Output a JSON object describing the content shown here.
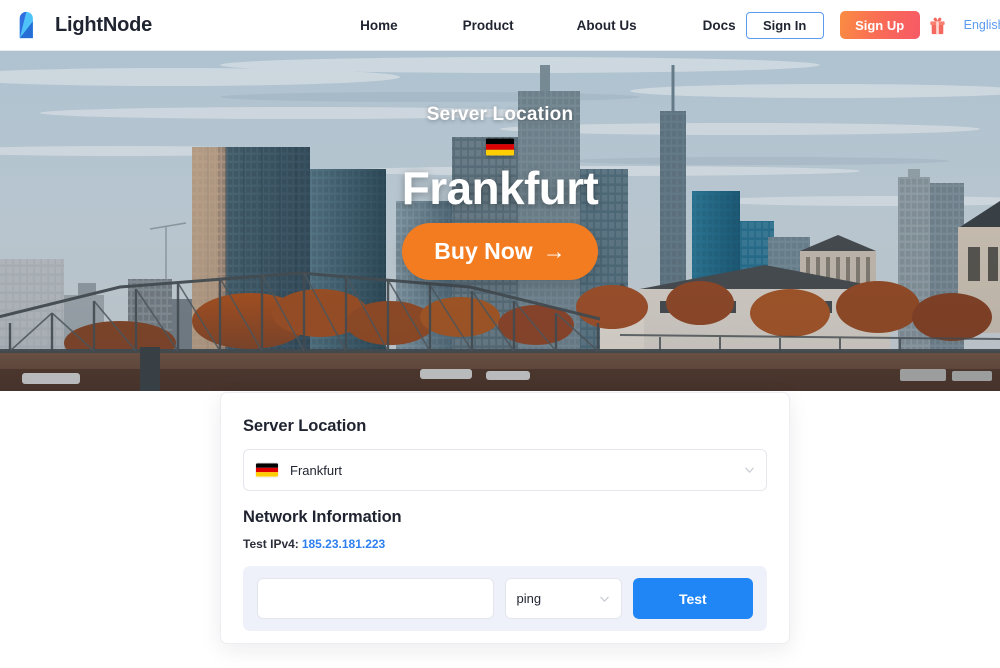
{
  "header": {
    "brand_name": "LightNode",
    "logo_icon": "lightnode-logo-icon",
    "nav": [
      {
        "label": "Home"
      },
      {
        "label": "Product"
      },
      {
        "label": "About Us"
      },
      {
        "label": "Docs"
      }
    ],
    "sign_in_label": "Sign In",
    "sign_up_label": "Sign Up",
    "gift_icon": "gift-icon",
    "language_label": "English",
    "colors": {
      "signin_border": "#5b9bf0",
      "signup_gradient_from": "#fa8c42",
      "signup_gradient_to": "#f75a66",
      "language_link": "#5b9bf0"
    }
  },
  "hero": {
    "label": "Server Location",
    "flag_icon": "flag-germany-icon",
    "city": "Frankfurt",
    "cta_label": "Buy Now",
    "cta_arrow": "→",
    "cta_color": "#f47c20",
    "background_alt": "Frankfurt skyline with Eiserner Steg bridge at dusk"
  },
  "card": {
    "server_location_title": "Server Location",
    "location_select": {
      "flag_icon": "flag-germany-icon",
      "value": "Frankfurt",
      "chevron_icon": "chevron-down-icon"
    },
    "network_information_title": "Network Information",
    "ip_label": "Test IPv4:",
    "ip_value": "185.23.181.223",
    "ip_value_color": "#2e7ff0",
    "test_panel": {
      "input_value": "",
      "input_placeholder": "",
      "method_value": "ping",
      "method_chevron_icon": "chevron-down-icon",
      "test_button_label": "Test",
      "test_button_color": "#2186f5",
      "panel_bg": "#eef1f9"
    }
  },
  "footer": {
    "strip_color": "#1b2349"
  }
}
